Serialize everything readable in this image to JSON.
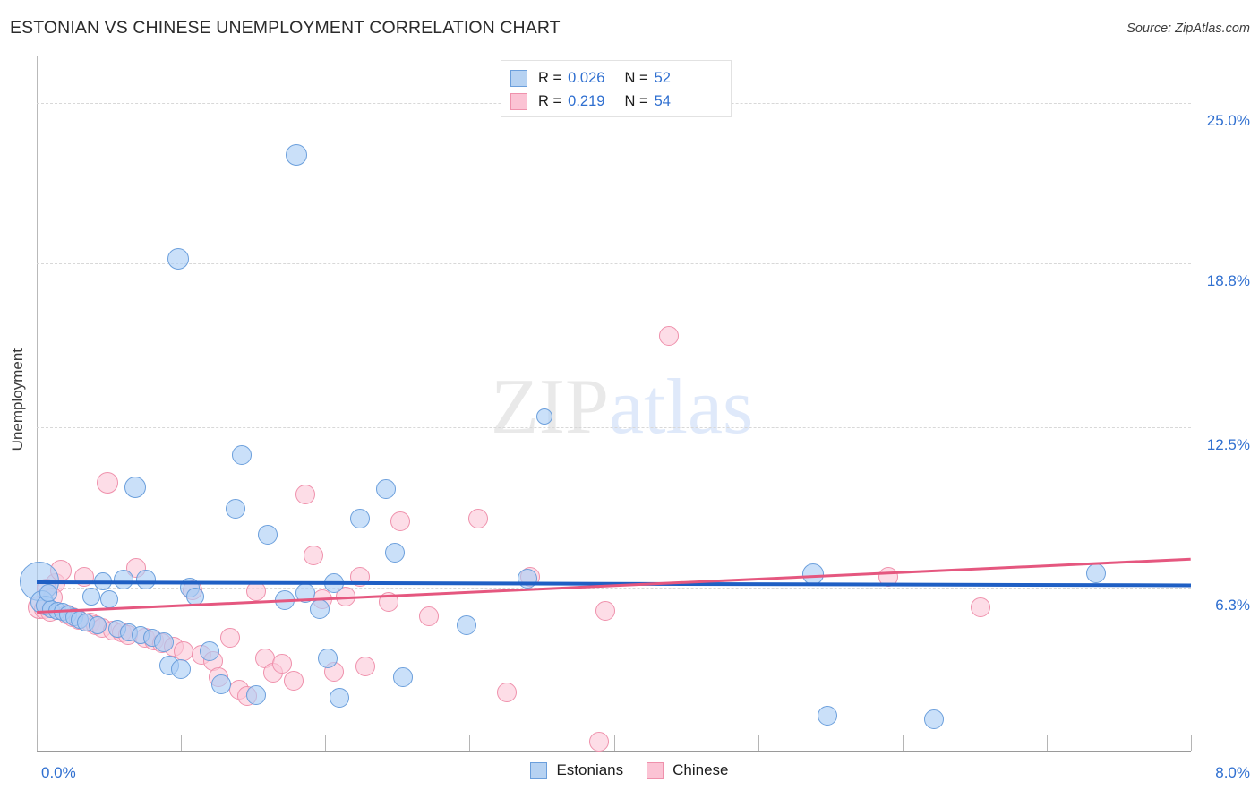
{
  "header": {
    "title": "ESTONIAN VS CHINESE UNEMPLOYMENT CORRELATION CHART",
    "source": "Source: ZipAtlas.com"
  },
  "watermark": {
    "part1": "ZIP",
    "part2": "atlas"
  },
  "stats": {
    "rows": [
      {
        "series": "Estonians",
        "color": "#b6d2f2",
        "r_label": "R =",
        "r_value": "0.026",
        "n_label": "N =",
        "n_value": "52"
      },
      {
        "series": "Chinese",
        "color": "#fbc3d4",
        "r_label": "R =",
        "r_value": "0.219",
        "n_label": "N =",
        "n_value": "54"
      }
    ]
  },
  "legend": {
    "items": [
      {
        "label": "Estonians",
        "color": "#b6d2f2"
      },
      {
        "label": "Chinese",
        "color": "#fbc3d4"
      }
    ]
  },
  "chart_data": {
    "type": "scatter",
    "title": "ESTONIAN VS CHINESE UNEMPLOYMENT CORRELATION CHART",
    "xlabel": "",
    "ylabel": "Unemployment",
    "xlim": [
      0.0,
      8.0
    ],
    "ylim": [
      0.0,
      26.8
    ],
    "grid": true,
    "legend_position": "bottom-center",
    "xtick_labels": [
      "0.0%",
      "8.0%"
    ],
    "xtick_values": [
      0.0,
      8.0
    ],
    "ytick_labels": [
      "25.0%",
      "18.8%",
      "12.5%",
      "6.3%"
    ],
    "ytick_values": [
      25.0,
      18.8,
      12.5,
      6.3
    ],
    "accent_color": "#2f6fd0",
    "series": [
      {
        "name": "Estonians",
        "color": "#b6d2f2",
        "edge_color": "#6b9fdc",
        "R": 0.026,
        "N": 52,
        "trendline": {
          "x0": 0.0,
          "y0": 6.57,
          "x1": 8.0,
          "y1": 6.45
        },
        "points": [
          {
            "x": 0.02,
            "y": 6.55,
            "r": 22
          },
          {
            "x": 0.04,
            "y": 5.75,
            "r": 13
          },
          {
            "x": 0.06,
            "y": 5.6,
            "r": 11
          },
          {
            "x": 0.1,
            "y": 5.45,
            "r": 10
          },
          {
            "x": 0.14,
            "y": 5.4,
            "r": 10
          },
          {
            "x": 0.18,
            "y": 5.35,
            "r": 10
          },
          {
            "x": 0.22,
            "y": 5.25,
            "r": 10
          },
          {
            "x": 0.26,
            "y": 5.15,
            "r": 10
          },
          {
            "x": 0.3,
            "y": 5.05,
            "r": 10
          },
          {
            "x": 0.34,
            "y": 4.95,
            "r": 10
          },
          {
            "x": 0.38,
            "y": 5.95,
            "r": 10
          },
          {
            "x": 0.42,
            "y": 4.85,
            "r": 10
          },
          {
            "x": 0.46,
            "y": 6.55,
            "r": 10
          },
          {
            "x": 0.5,
            "y": 5.85,
            "r": 10
          },
          {
            "x": 0.56,
            "y": 4.7,
            "r": 10
          },
          {
            "x": 0.6,
            "y": 6.6,
            "r": 11
          },
          {
            "x": 0.64,
            "y": 4.55,
            "r": 10
          },
          {
            "x": 0.68,
            "y": 10.15,
            "r": 12
          },
          {
            "x": 0.72,
            "y": 4.45,
            "r": 10
          },
          {
            "x": 0.76,
            "y": 6.6,
            "r": 11
          },
          {
            "x": 0.8,
            "y": 4.35,
            "r": 10
          },
          {
            "x": 0.88,
            "y": 4.2,
            "r": 11
          },
          {
            "x": 0.92,
            "y": 3.3,
            "r": 11
          },
          {
            "x": 0.98,
            "y": 19.0,
            "r": 12
          },
          {
            "x": 1.0,
            "y": 3.15,
            "r": 11
          },
          {
            "x": 1.06,
            "y": 6.3,
            "r": 11
          },
          {
            "x": 1.1,
            "y": 5.95,
            "r": 10
          },
          {
            "x": 1.2,
            "y": 3.85,
            "r": 11
          },
          {
            "x": 1.28,
            "y": 2.55,
            "r": 11
          },
          {
            "x": 1.38,
            "y": 9.35,
            "r": 11
          },
          {
            "x": 1.42,
            "y": 11.4,
            "r": 11
          },
          {
            "x": 1.52,
            "y": 2.15,
            "r": 11
          },
          {
            "x": 1.6,
            "y": 8.35,
            "r": 11
          },
          {
            "x": 1.72,
            "y": 5.8,
            "r": 11
          },
          {
            "x": 1.8,
            "y": 23.0,
            "r": 12
          },
          {
            "x": 1.86,
            "y": 6.1,
            "r": 11
          },
          {
            "x": 1.96,
            "y": 5.45,
            "r": 11
          },
          {
            "x": 2.02,
            "y": 3.55,
            "r": 11
          },
          {
            "x": 2.06,
            "y": 6.45,
            "r": 11
          },
          {
            "x": 2.1,
            "y": 2.05,
            "r": 11
          },
          {
            "x": 2.24,
            "y": 8.95,
            "r": 11
          },
          {
            "x": 2.42,
            "y": 10.1,
            "r": 11
          },
          {
            "x": 2.48,
            "y": 7.65,
            "r": 11
          },
          {
            "x": 2.54,
            "y": 2.85,
            "r": 11
          },
          {
            "x": 2.98,
            "y": 4.85,
            "r": 11
          },
          {
            "x": 3.4,
            "y": 6.65,
            "r": 11
          },
          {
            "x": 3.52,
            "y": 12.9,
            "r": 9
          },
          {
            "x": 5.38,
            "y": 6.8,
            "r": 12
          },
          {
            "x": 5.48,
            "y": 1.35,
            "r": 11
          },
          {
            "x": 6.22,
            "y": 1.2,
            "r": 11
          },
          {
            "x": 7.34,
            "y": 6.85,
            "r": 11
          },
          {
            "x": 0.08,
            "y": 6.1,
            "r": 10
          }
        ]
      },
      {
        "name": "Chinese",
        "color": "#fbc3d4",
        "edge_color": "#ef91ac",
        "R": 0.219,
        "N": 54,
        "trendline": {
          "x0": 0.0,
          "y0": 5.4,
          "x1": 8.0,
          "y1": 7.45
        },
        "points": [
          {
            "x": 0.02,
            "y": 5.55,
            "r": 13
          },
          {
            "x": 0.05,
            "y": 5.45,
            "r": 11
          },
          {
            "x": 0.09,
            "y": 5.35,
            "r": 11
          },
          {
            "x": 0.13,
            "y": 6.45,
            "r": 11
          },
          {
            "x": 0.17,
            "y": 6.95,
            "r": 12
          },
          {
            "x": 0.21,
            "y": 5.25,
            "r": 11
          },
          {
            "x": 0.25,
            "y": 5.15,
            "r": 11
          },
          {
            "x": 0.29,
            "y": 5.05,
            "r": 11
          },
          {
            "x": 0.33,
            "y": 6.7,
            "r": 11
          },
          {
            "x": 0.37,
            "y": 4.95,
            "r": 11
          },
          {
            "x": 0.41,
            "y": 4.85,
            "r": 11
          },
          {
            "x": 0.45,
            "y": 4.75,
            "r": 11
          },
          {
            "x": 0.49,
            "y": 10.35,
            "r": 12
          },
          {
            "x": 0.53,
            "y": 4.65,
            "r": 11
          },
          {
            "x": 0.59,
            "y": 4.55,
            "r": 11
          },
          {
            "x": 0.63,
            "y": 4.45,
            "r": 11
          },
          {
            "x": 0.69,
            "y": 7.05,
            "r": 11
          },
          {
            "x": 0.75,
            "y": 4.35,
            "r": 11
          },
          {
            "x": 0.81,
            "y": 4.25,
            "r": 11
          },
          {
            "x": 0.87,
            "y": 4.15,
            "r": 11
          },
          {
            "x": 0.95,
            "y": 4.0,
            "r": 11
          },
          {
            "x": 1.02,
            "y": 3.85,
            "r": 11
          },
          {
            "x": 1.08,
            "y": 6.2,
            "r": 11
          },
          {
            "x": 1.14,
            "y": 3.7,
            "r": 11
          },
          {
            "x": 1.22,
            "y": 3.45,
            "r": 11
          },
          {
            "x": 1.26,
            "y": 2.85,
            "r": 11
          },
          {
            "x": 1.34,
            "y": 4.35,
            "r": 11
          },
          {
            "x": 1.4,
            "y": 2.35,
            "r": 11
          },
          {
            "x": 1.46,
            "y": 2.1,
            "r": 11
          },
          {
            "x": 1.52,
            "y": 6.15,
            "r": 11
          },
          {
            "x": 1.58,
            "y": 3.55,
            "r": 11
          },
          {
            "x": 1.64,
            "y": 3.0,
            "r": 11
          },
          {
            "x": 1.7,
            "y": 3.35,
            "r": 11
          },
          {
            "x": 1.78,
            "y": 2.7,
            "r": 11
          },
          {
            "x": 1.86,
            "y": 9.9,
            "r": 11
          },
          {
            "x": 1.92,
            "y": 7.55,
            "r": 11
          },
          {
            "x": 1.98,
            "y": 5.85,
            "r": 11
          },
          {
            "x": 2.06,
            "y": 3.05,
            "r": 11
          },
          {
            "x": 2.14,
            "y": 5.95,
            "r": 11
          },
          {
            "x": 2.24,
            "y": 6.7,
            "r": 11
          },
          {
            "x": 2.28,
            "y": 3.25,
            "r": 11
          },
          {
            "x": 2.44,
            "y": 5.75,
            "r": 11
          },
          {
            "x": 2.52,
            "y": 8.85,
            "r": 11
          },
          {
            "x": 2.72,
            "y": 5.2,
            "r": 11
          },
          {
            "x": 3.06,
            "y": 8.95,
            "r": 11
          },
          {
            "x": 3.26,
            "y": 2.25,
            "r": 11
          },
          {
            "x": 3.42,
            "y": 6.7,
            "r": 11
          },
          {
            "x": 3.9,
            "y": 0.35,
            "r": 11
          },
          {
            "x": 3.94,
            "y": 5.4,
            "r": 11
          },
          {
            "x": 4.38,
            "y": 16.0,
            "r": 11
          },
          {
            "x": 5.9,
            "y": 6.7,
            "r": 11
          },
          {
            "x": 6.54,
            "y": 5.55,
            "r": 11
          },
          {
            "x": 0.07,
            "y": 6.25,
            "r": 11
          },
          {
            "x": 0.11,
            "y": 5.9,
            "r": 11
          }
        ]
      }
    ]
  }
}
